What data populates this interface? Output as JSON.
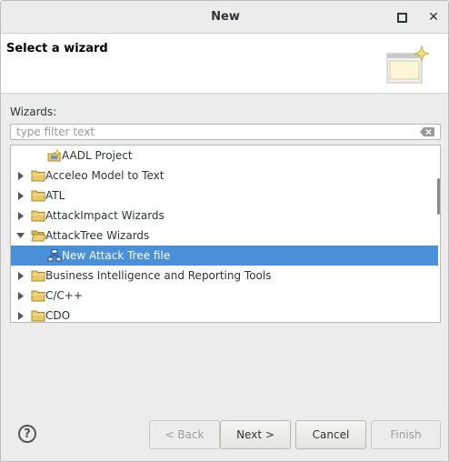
{
  "window": {
    "title": "New"
  },
  "header": {
    "title": "Select a wizard"
  },
  "wizards_label": "Wizards:",
  "filter": {
    "placeholder": "type filter text",
    "value": ""
  },
  "tree": {
    "items": [
      {
        "label": "AADL Project",
        "expandable": false,
        "icon": "project-icon"
      },
      {
        "label": "Acceleo Model to Text",
        "expandable": true,
        "expanded": false,
        "icon": "folder-icon"
      },
      {
        "label": "ATL",
        "expandable": true,
        "expanded": false,
        "icon": "folder-icon"
      },
      {
        "label": "AttackImpact Wizards",
        "expandable": true,
        "expanded": false,
        "icon": "folder-icon"
      },
      {
        "label": "AttackTree Wizards",
        "expandable": true,
        "expanded": true,
        "icon": "folder-icon"
      },
      {
        "label": "New Attack Tree file",
        "expandable": false,
        "selected": true,
        "icon": "tree-file-icon"
      },
      {
        "label": "Business Intelligence and Reporting Tools",
        "expandable": true,
        "expanded": false,
        "icon": "folder-icon"
      },
      {
        "label": "C/C++",
        "expandable": true,
        "expanded": false,
        "icon": "folder-icon"
      },
      {
        "label": "CDO",
        "expandable": true,
        "expanded": false,
        "icon": "folder-icon"
      }
    ]
  },
  "buttons": {
    "help": "?",
    "back": "< Back",
    "next": "Next >",
    "cancel": "Cancel",
    "finish": "Finish"
  },
  "colors": {
    "selection": "#4a90d9",
    "folder": "#e8c96a"
  }
}
